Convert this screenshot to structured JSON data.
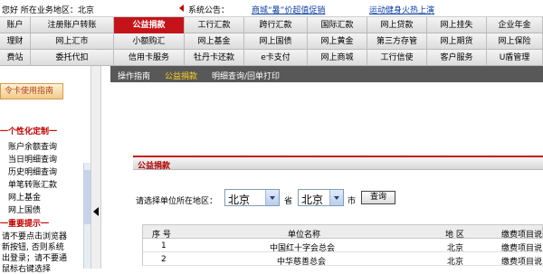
{
  "top": {
    "location": "您好 所在业务地区：北京",
    "announcement_label": "系统公告：",
    "announcements": [
      "商城“暑”价超值促销",
      "运动健身火热上演"
    ]
  },
  "menu_rows": [
    [
      "账户",
      "注册账户转账",
      "公益捐款",
      "工行汇款",
      "跨行汇款",
      "国际汇款",
      "网上贷款",
      "网上挂失",
      "企业年金"
    ],
    [
      "理财",
      "网上汇市",
      "小额购汇",
      "网上基金",
      "网上国债",
      "网上黄金",
      "第三方存管",
      "网上期货",
      "网上保险"
    ],
    [
      "费站",
      "委托代扣",
      "信用卡服务",
      "牡丹卡还款",
      "e卡支付",
      "网上商城",
      "工行信使",
      "客户服务",
      "U盾管理"
    ]
  ],
  "active_menu": "公益捐款",
  "subnav": [
    "操作指南",
    "公益捐款",
    "明细查询/回单打印"
  ],
  "sidebar": {
    "card_guide": "令卡使用指南",
    "personal_section": "一个性化定制一",
    "links": [
      "账户余额查询",
      "当日明细查询",
      "历史明细查询",
      "单笔转账汇款",
      "网上基金",
      "网上国债"
    ],
    "notice_section": "一重要提示一",
    "notices": [
      "请不要点击浏览器",
      "新按钮, 否则系统",
      "出登录；请不要通",
      "鼠标右键选择"
    ]
  },
  "panel": {
    "title": "公益捐款",
    "region_label": "请选择单位所在地区：",
    "province_value": "北京",
    "province_suffix": "省",
    "city_value": "北京",
    "city_suffix": "市",
    "query_button": "查询"
  },
  "table": {
    "headers": [
      "序 号",
      "单位名称",
      "地 区",
      "缴费项目说"
    ],
    "rows": [
      [
        "1",
        "中国红十字会总会",
        "北京",
        "缴费项目说"
      ],
      [
        "2",
        "中华慈善总会",
        "北京",
        "缴费项目说"
      ]
    ]
  }
}
